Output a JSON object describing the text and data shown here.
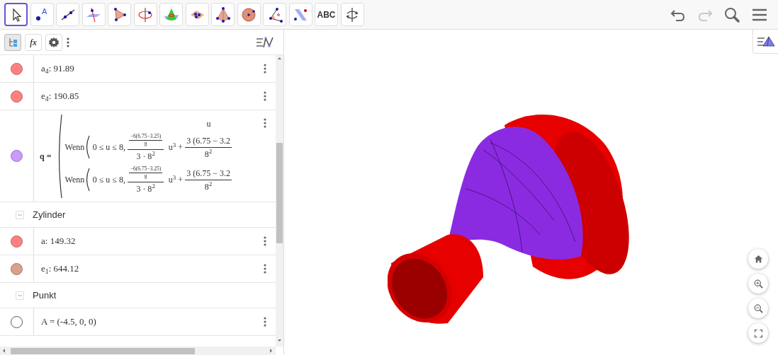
{
  "toolbar": {
    "tools": [
      {
        "kind": "move",
        "selected": true
      },
      {
        "kind": "point",
        "label": "A",
        "selected": false
      },
      {
        "kind": "line",
        "selected": false
      },
      {
        "kind": "perpendicular",
        "selected": false
      },
      {
        "kind": "polygon",
        "selected": false
      },
      {
        "kind": "circle-axis",
        "selected": false
      },
      {
        "kind": "cone",
        "selected": false
      },
      {
        "kind": "plane",
        "selected": false
      },
      {
        "kind": "pyramid",
        "selected": false
      },
      {
        "kind": "sphere",
        "selected": false
      },
      {
        "kind": "angle",
        "selected": false
      },
      {
        "kind": "reflect",
        "selected": false
      },
      {
        "kind": "text",
        "label": "ABC",
        "selected": false
      },
      {
        "kind": "rotate",
        "selected": false
      }
    ],
    "actions": [
      {
        "kind": "undo",
        "disabled": false
      },
      {
        "kind": "redo",
        "disabled": true
      },
      {
        "kind": "search",
        "disabled": false
      },
      {
        "kind": "menu",
        "disabled": false
      }
    ]
  },
  "algebra": {
    "header": {
      "buttons": [
        {
          "kind": "tree",
          "selected": true
        },
        {
          "kind": "fx",
          "label": "fx",
          "selected": false
        },
        {
          "kind": "settings",
          "selected": false
        }
      ]
    },
    "items": [
      {
        "kind": "value",
        "text": "a$_{4}$: 91.89",
        "color": "#ff8080",
        "visible": true
      },
      {
        "kind": "value",
        "text": "e$_{4}$: 190.85",
        "color": "#ff8080",
        "visible": true
      },
      {
        "kind": "formula",
        "name": "q =",
        "top": "u",
        "color": "#cc99ff",
        "visible": true,
        "lines": [
          {
            "keyword": "Wenn",
            "condition": "0 ≤ u ≤ 8,",
            "num_num": "−6(6.75−3.25)",
            "num_den": "8",
            "den": "3 · 8$^{2}$",
            "term": "u$^{3}$ +",
            "frac_num": "3 (6.75 − 3.2",
            "frac_den": "8$^{2}$"
          },
          {
            "keyword": "Wenn",
            "condition": "0 ≤ u ≤ 8,",
            "num_num": "−6(6.75−3.25)",
            "num_den": "8",
            "den": "3 · 8$^{2}$",
            "term": "u$^{3}$ +",
            "frac_num": "3 (6.75 − 3.2",
            "frac_den": "8$^{2}$"
          }
        ]
      },
      {
        "kind": "group",
        "text": "Zylinder",
        "expanded": true
      },
      {
        "kind": "value",
        "text": "a: 149.32",
        "color": "#ff8080",
        "visible": true
      },
      {
        "kind": "value",
        "text": "e$_{1}$: 644.12",
        "color": "#d9a08c",
        "visible": true
      },
      {
        "kind": "group",
        "text": "Punkt",
        "expanded": true
      },
      {
        "kind": "value",
        "text": "A = (-4.5, 0, 0)",
        "visible": false
      }
    ]
  },
  "graphics": {
    "controls": [
      {
        "kind": "home"
      },
      {
        "kind": "zoom-in"
      },
      {
        "kind": "zoom-out"
      },
      {
        "kind": "fullscreen"
      }
    ]
  }
}
